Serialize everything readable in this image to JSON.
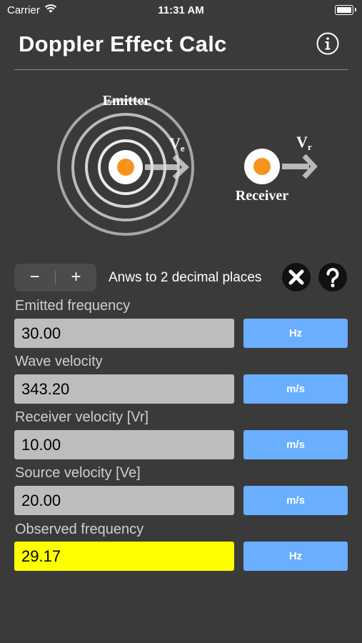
{
  "status_bar": {
    "carrier": "Carrier",
    "time": "11:31 AM"
  },
  "header": {
    "title": "Doppler Effect Calc"
  },
  "diagram": {
    "emitter_label": "Emitter",
    "receiver_label": "Receiver",
    "ve_label": "V",
    "ve_sub": "e",
    "vr_label": "V",
    "vr_sub": "r",
    "dot_color": "#f7941d"
  },
  "controls": {
    "minus": "−",
    "plus": "+",
    "decimals_text": "Anws to 2 decimal places"
  },
  "fields": {
    "emitted_frequency": {
      "label": "Emitted frequency",
      "value": "30.00",
      "unit": "Hz"
    },
    "wave_velocity": {
      "label": "Wave velocity",
      "value": "343.20",
      "unit": "m/s"
    },
    "receiver_velocity": {
      "label": "Receiver velocity [Vr]",
      "value": "10.00",
      "unit": "m/s"
    },
    "source_velocity": {
      "label": "Source velocity [Ve]",
      "value": "20.00",
      "unit": "m/s"
    },
    "observed_frequency": {
      "label": "Observed frequency",
      "value": "29.17",
      "unit": "Hz"
    }
  },
  "colors": {
    "background": "#3a3a3a",
    "unit_button": "#6aaeff",
    "result_field": "#ffff00",
    "input_field": "#bdbdbd"
  }
}
